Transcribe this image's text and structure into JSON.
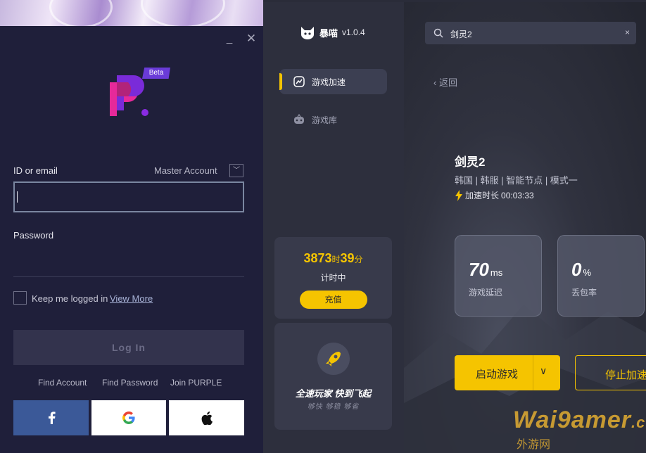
{
  "login": {
    "window": {
      "minimize_icon": "minimize-icon",
      "close_icon": "close-icon"
    },
    "logo_badge": "Beta",
    "id_label": "ID or email",
    "account_type": "Master Account",
    "id_value": "",
    "password_label": "Password",
    "keep_logged_in": "Keep me logged in",
    "view_more": "View More",
    "login_button": "Log In",
    "links": {
      "find_account": "Find Account",
      "find_password": "Find Password",
      "join": "Join PURPLE"
    },
    "social": [
      "facebook-icon",
      "google-icon",
      "apple-icon"
    ]
  },
  "app": {
    "name": "暴喵",
    "version": "v1.0.4",
    "nav": {
      "accelerate": "游戏加速",
      "library": "游戏库"
    },
    "time_card": {
      "hours": "3873",
      "hours_unit": "时",
      "minutes": "39",
      "minutes_unit": "分",
      "status": "计时中",
      "recharge": "充值"
    },
    "promo": {
      "headline": "全速玩家  快到飞起",
      "sub": "够快  够稳  够省"
    },
    "search": {
      "value": "剑灵2",
      "clear": "×"
    },
    "back": "返回",
    "game": {
      "title": "剑灵2",
      "tags": "韩国 | 韩服 | 智能节点 | 模式一",
      "duration_label": "加速时长",
      "duration": "00:03:33"
    },
    "stats": {
      "latency": {
        "value": "70",
        "unit": "ms",
        "caption": "游戏延迟"
      },
      "loss": {
        "value": "0",
        "unit": "%",
        "caption": "丢包率"
      }
    },
    "start_button": "启动游戏",
    "stop_button": "停止加速",
    "accent": "#f5c400"
  },
  "watermark": {
    "main": "Wai9amer",
    "domain": ".com",
    "sub": "外游网"
  }
}
